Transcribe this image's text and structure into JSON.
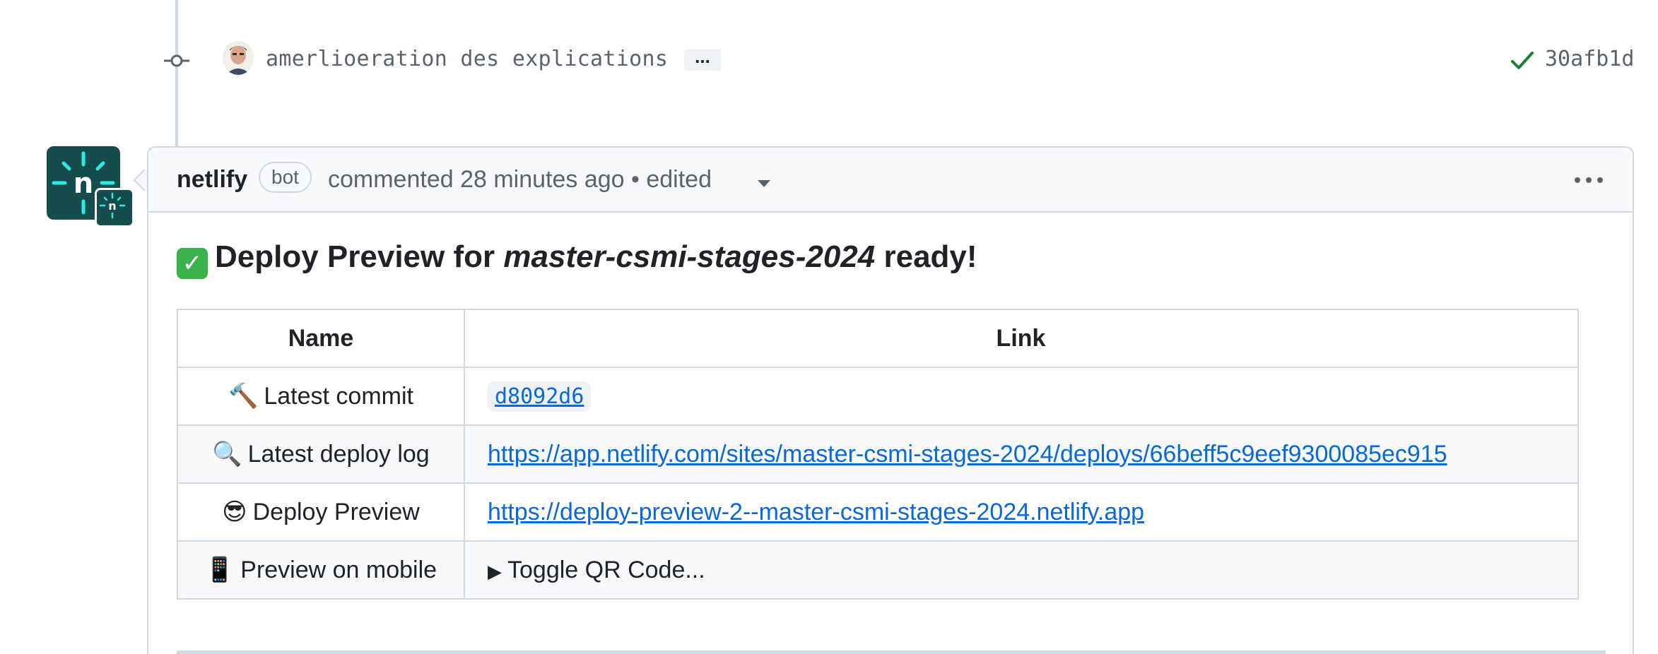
{
  "commit": {
    "message": "amerlioeration des explications",
    "ellipsis": "...",
    "sha": "30afb1d",
    "status": "success"
  },
  "comment": {
    "author": "netlify",
    "author_label": "bot",
    "meta": "commented 28 minutes ago • edited",
    "heading_prefix": "Deploy Preview for",
    "heading_site": "master-csmi-stages-2024",
    "heading_suffix": "ready!",
    "table": {
      "headers": [
        "Name",
        "Link"
      ],
      "rows": [
        {
          "emoji": "🔨",
          "name": "Latest commit",
          "link": "d8092d6"
        },
        {
          "emoji": "🔍",
          "name": "Latest deploy log",
          "link": "https://app.netlify.com/sites/master-csmi-stages-2024/deploys/66beff5c9eef9300085ec915"
        },
        {
          "emoji": "😎",
          "name": "Deploy Preview",
          "link": "https://deploy-preview-2--master-csmi-stages-2024.netlify.app"
        },
        {
          "emoji": "📱",
          "name": "Preview on mobile",
          "link": "Toggle QR Code..."
        }
      ]
    }
  },
  "icons": {
    "commit_node": "git-commit-icon",
    "check": "check-icon",
    "kebab": "kebab-horizontal-icon",
    "caret": "triangle-down-icon",
    "avatar": "netlify-logo-icon"
  },
  "colors": {
    "link": "#0969da",
    "success": "#1a7f37",
    "netlify_teal": "#144d4b"
  }
}
